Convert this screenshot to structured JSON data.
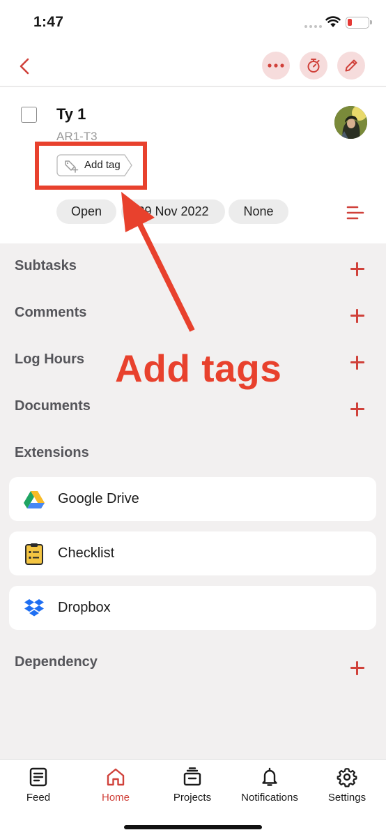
{
  "status_bar": {
    "time": "1:47"
  },
  "task": {
    "title": "Ty 1",
    "id": "AR1-T3",
    "add_tag_label": "Add tag",
    "status": "Open",
    "date": "29 Nov 2022",
    "priority": "None"
  },
  "sections": {
    "subtasks": "Subtasks",
    "comments": "Comments",
    "log_hours": "Log Hours",
    "documents": "Documents",
    "extensions": "Extensions",
    "dependency": "Dependency"
  },
  "extensions": [
    {
      "label": "Google Drive",
      "icon": "google-drive-icon"
    },
    {
      "label": "Checklist",
      "icon": "checklist-icon"
    },
    {
      "label": "Dropbox",
      "icon": "dropbox-icon"
    }
  ],
  "annotation": {
    "text": "Add tags",
    "color": "#e8412d"
  },
  "tabs": [
    {
      "label": "Feed",
      "icon": "feed-icon"
    },
    {
      "label": "Home",
      "icon": "home-icon",
      "active": true
    },
    {
      "label": "Projects",
      "icon": "projects-icon"
    },
    {
      "label": "Notifications",
      "icon": "bell-icon"
    },
    {
      "label": "Settings",
      "icon": "gear-icon"
    }
  ],
  "colors": {
    "accent": "#d0413a",
    "accent_soft": "#f6dcdc",
    "background": "#f2f0f0"
  }
}
